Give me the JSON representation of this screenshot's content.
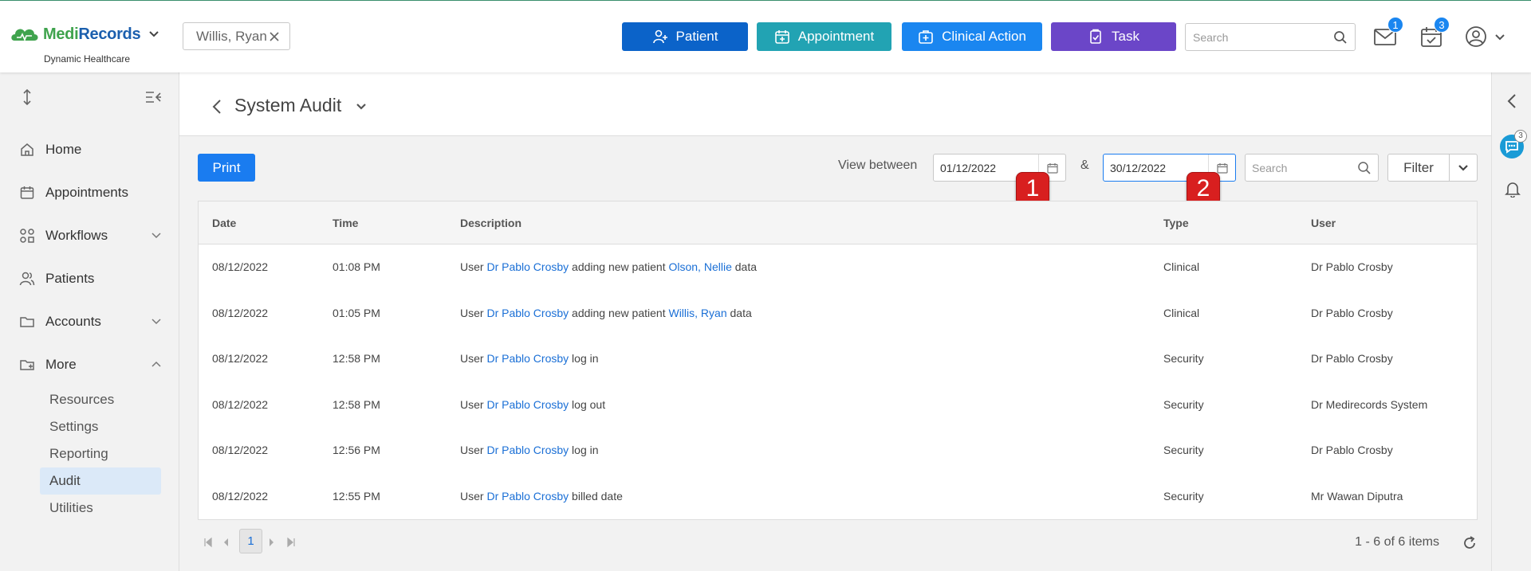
{
  "header": {
    "logo": {
      "medi": "Medi",
      "records": "Records",
      "tagline": "Dynamic Healthcare"
    },
    "patient_chip": "Willis, Ryan",
    "buttons": {
      "patient": "Patient",
      "appointment": "Appointment",
      "clinical_action": "Clinical Action",
      "task": "Task"
    },
    "search_placeholder": "Search",
    "mail_badge": "1",
    "tasks_badge": "3"
  },
  "sidebar": {
    "items": [
      {
        "label": "Home",
        "icon": "home-icon"
      },
      {
        "label": "Appointments",
        "icon": "calendar-icon"
      },
      {
        "label": "Workflows",
        "icon": "workflow-icon"
      },
      {
        "label": "Patients",
        "icon": "patients-icon"
      },
      {
        "label": "Accounts",
        "icon": "folder-icon"
      },
      {
        "label": "More",
        "icon": "folder-more-icon"
      }
    ],
    "more_sub": [
      {
        "label": "Resources"
      },
      {
        "label": "Settings"
      },
      {
        "label": "Reporting"
      },
      {
        "label": "Audit",
        "active": true
      },
      {
        "label": "Utilities"
      }
    ]
  },
  "page": {
    "title": "System Audit",
    "print": "Print",
    "view_between": "View between",
    "amp": "&",
    "date_from": "01/12/2022",
    "date_to": "30/12/2022",
    "search_placeholder": "Search",
    "filter": "Filter",
    "markers": [
      "1",
      "2"
    ]
  },
  "table": {
    "columns": [
      "Date",
      "Time",
      "Description",
      "Type",
      "User"
    ],
    "rows": [
      {
        "date": "08/12/2022",
        "time": "01:08 PM",
        "pre": "User ",
        "actor": "Dr Pablo Crosby",
        "mid": " adding new patient ",
        "patient": "Olson, Nellie",
        "post": " data",
        "type": "Clinical",
        "user": "Dr Pablo Crosby"
      },
      {
        "date": "08/12/2022",
        "time": "01:05 PM",
        "pre": "User ",
        "actor": "Dr Pablo Crosby",
        "mid": " adding new patient ",
        "patient": "Willis, Ryan",
        "post": " data",
        "type": "Clinical",
        "user": "Dr Pablo Crosby"
      },
      {
        "date": "08/12/2022",
        "time": "12:58 PM",
        "pre": "User ",
        "actor": "Dr Pablo Crosby",
        "mid": " log in",
        "patient": "",
        "post": "",
        "type": "Security",
        "user": "Dr Pablo Crosby"
      },
      {
        "date": "08/12/2022",
        "time": "12:58 PM",
        "pre": "User ",
        "actor": "Dr Pablo Crosby",
        "mid": " log out",
        "patient": "",
        "post": "",
        "type": "Security",
        "user": "Dr Medirecords System"
      },
      {
        "date": "08/12/2022",
        "time": "12:56 PM",
        "pre": "User ",
        "actor": "Dr Pablo Crosby",
        "mid": " log in",
        "patient": "",
        "post": "",
        "type": "Security",
        "user": "Dr Pablo Crosby"
      },
      {
        "date": "08/12/2022",
        "time": "12:55 PM",
        "pre": "User ",
        "actor": "Dr Pablo Crosby",
        "mid": " billed date",
        "patient": "",
        "post": "",
        "type": "Security",
        "user": "Mr Wawan Diputra"
      }
    ]
  },
  "pager": {
    "page": "1",
    "items": "1 - 6 of 6 items"
  },
  "rail": {
    "chat_badge": "3"
  },
  "colors": {
    "patient_btn": "#0b63c9",
    "appointment_btn": "#22a3b3",
    "clinical_btn": "#1a86f0",
    "task_btn": "#6b46c8",
    "link": "#1a6fd6",
    "marker": "#d81f1f"
  }
}
